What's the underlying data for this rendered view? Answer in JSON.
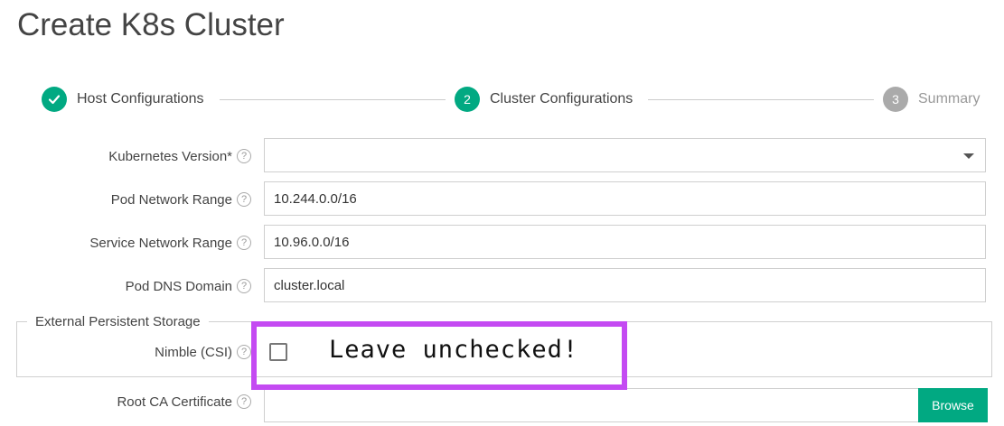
{
  "page": {
    "title": "Create K8s Cluster"
  },
  "stepper": {
    "steps": [
      {
        "number": "",
        "label": "Host Configurations",
        "state": "done"
      },
      {
        "number": "2",
        "label": "Cluster Configurations",
        "state": "active"
      },
      {
        "number": "3",
        "label": "Summary",
        "state": "pending"
      }
    ]
  },
  "form": {
    "kubernetes_version": {
      "label": "Kubernetes Version*",
      "value": ""
    },
    "pod_network_range": {
      "label": "Pod Network Range",
      "value": "10.244.0.0/16"
    },
    "service_network_range": {
      "label": "Service Network Range",
      "value": "10.96.0.0/16"
    },
    "pod_dns_domain": {
      "label": "Pod DNS Domain",
      "value": "cluster.local"
    },
    "external_storage": {
      "legend": "External Persistent Storage",
      "nimble_label": "Nimble (CSI)",
      "nimble_checked": false
    },
    "root_ca": {
      "label": "Root CA Certificate",
      "value": "",
      "browse_label": "Browse"
    }
  },
  "annotation": {
    "text": "Leave unchecked!",
    "color": "#c44af2"
  },
  "colors": {
    "accent": "#01a982",
    "pending": "#aaaaaa"
  },
  "icons": {
    "help": "question-circle-icon",
    "check": "check-icon",
    "dropdown": "chevron-down-icon"
  }
}
